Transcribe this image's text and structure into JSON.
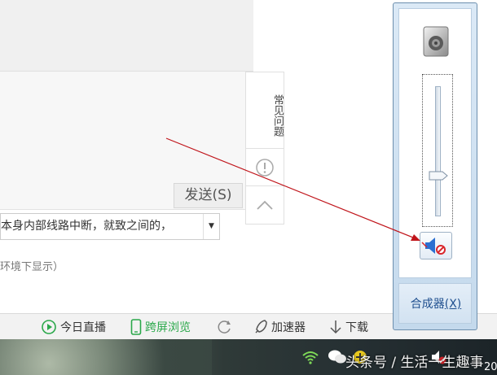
{
  "chat": {
    "send_label": "发送(S)",
    "dropdown_text": "本身内部线路中断，就致之间的，",
    "note_text": "环境下显示）"
  },
  "side_tools": {
    "faq_label": "常见问题"
  },
  "statusbar": {
    "live_label": "今日直播",
    "cross_screen_label": "跨屏浏览",
    "accelerator_label": "加速器",
    "download_label": "下载",
    "accent_green": "#2aa84a"
  },
  "mixer": {
    "link_label": "合成器",
    "link_shortcut": "(X)",
    "level_percent": 30,
    "muted": true
  },
  "taskbar": {
    "watermark": "头条号 / 生活一生趣事",
    "clock_fragment": "20"
  },
  "icons": {
    "speaker": "speaker-icon",
    "mute": "speaker-muted-icon",
    "wifi": "wifi-icon",
    "wechat": "wechat-icon"
  }
}
